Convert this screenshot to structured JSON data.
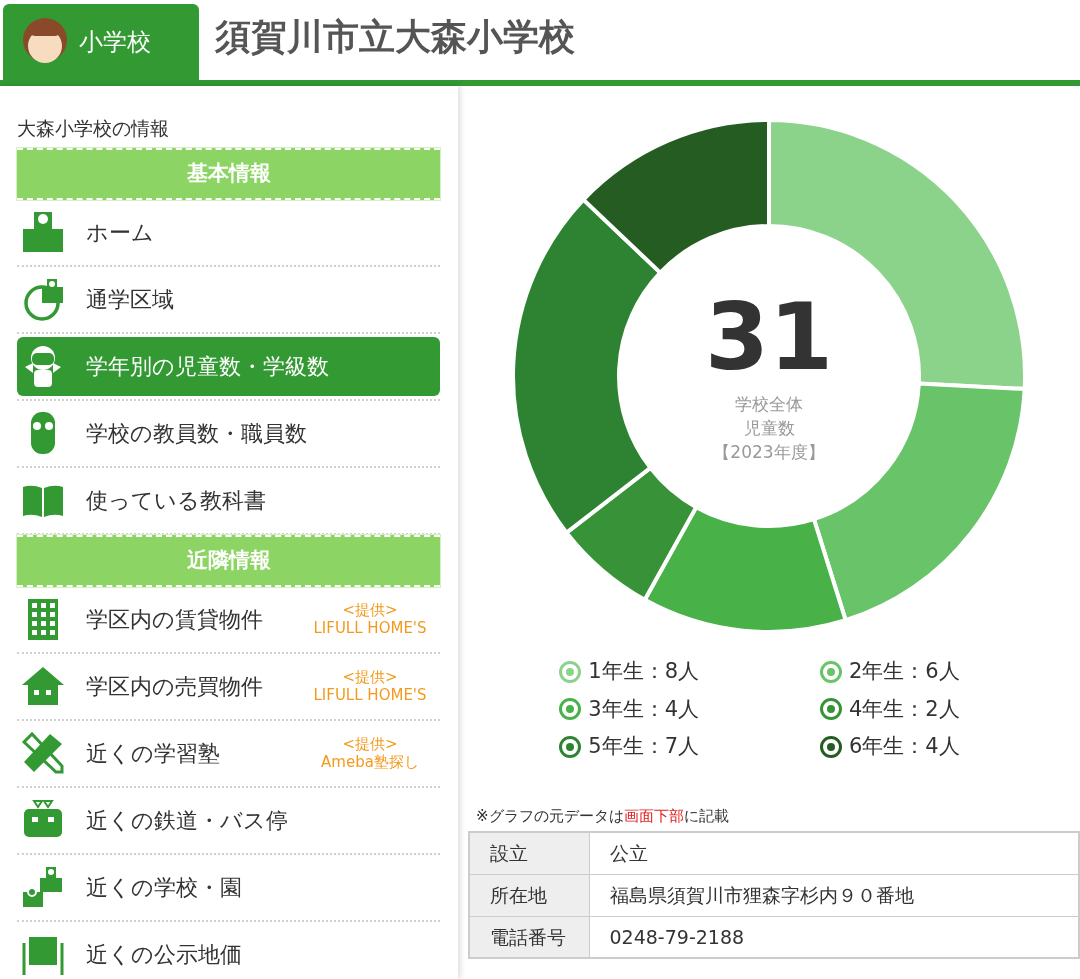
{
  "header": {
    "badge": "小学校",
    "title": "須賀川市立大森小学校"
  },
  "sidebar": {
    "heading": "大森小学校の情報",
    "items": [
      {
        "kind": "header",
        "label": "基本情報"
      },
      {
        "kind": "nav",
        "label": "ホーム",
        "selected": false
      },
      {
        "kind": "nav",
        "label": "通学区域",
        "selected": false
      },
      {
        "kind": "nav",
        "label": "学年別の児童数・学級数",
        "selected": true
      },
      {
        "kind": "nav",
        "label": "学校の教員数・職員数",
        "selected": false
      },
      {
        "kind": "nav",
        "label": "使っている教科書",
        "selected": false
      },
      {
        "kind": "header",
        "label": "近隣情報"
      },
      {
        "kind": "nav",
        "label": "学区内の賃貸物件",
        "selected": false,
        "provider": [
          "<提供>",
          "LIFULL HOME'S"
        ]
      },
      {
        "kind": "nav",
        "label": "学区内の売買物件",
        "selected": false,
        "provider": [
          "<提供>",
          "LIFULL HOME'S"
        ]
      },
      {
        "kind": "nav",
        "label": "近くの学習塾",
        "selected": false,
        "provider": [
          "<提供>",
          "Ameba塾探し"
        ]
      },
      {
        "kind": "nav",
        "label": "近くの鉄道・バス停",
        "selected": false
      },
      {
        "kind": "nav",
        "label": "近くの学校・園",
        "selected": false
      },
      {
        "kind": "nav",
        "label": "近くの公示地価",
        "selected": false
      }
    ]
  },
  "chart": {
    "center_value": "31",
    "center_lines": [
      "学校全体",
      "児童数",
      "【2023年度】"
    ],
    "chart_data": {
      "type": "donut",
      "categories": [
        "1年生：8人",
        "2年生：6人",
        "3年生：4人",
        "4年生：2人",
        "5年生：7人",
        "6年生：4人"
      ],
      "series": [
        {
          "values": [
            8,
            6,
            4,
            2,
            7,
            4
          ]
        }
      ]
    },
    "legend": [
      {
        "color": "#8bd38b"
      },
      {
        "color": "#69c369"
      },
      {
        "color": "#48b148"
      },
      {
        "color": "#389338"
      },
      {
        "color": "#2e8332"
      },
      {
        "color": "#245c22"
      }
    ]
  },
  "note": {
    "before": "※グラフの元データは",
    "link": "画面下部",
    "after": "に記載"
  },
  "table": {
    "rows": [
      {
        "label": "設立",
        "value": "公立"
      },
      {
        "label": "所在地",
        "value": "福島県須賀川市狸森字杉内９０番地"
      },
      {
        "label": "電話番号",
        "value": "0248-79-2188"
      }
    ]
  }
}
